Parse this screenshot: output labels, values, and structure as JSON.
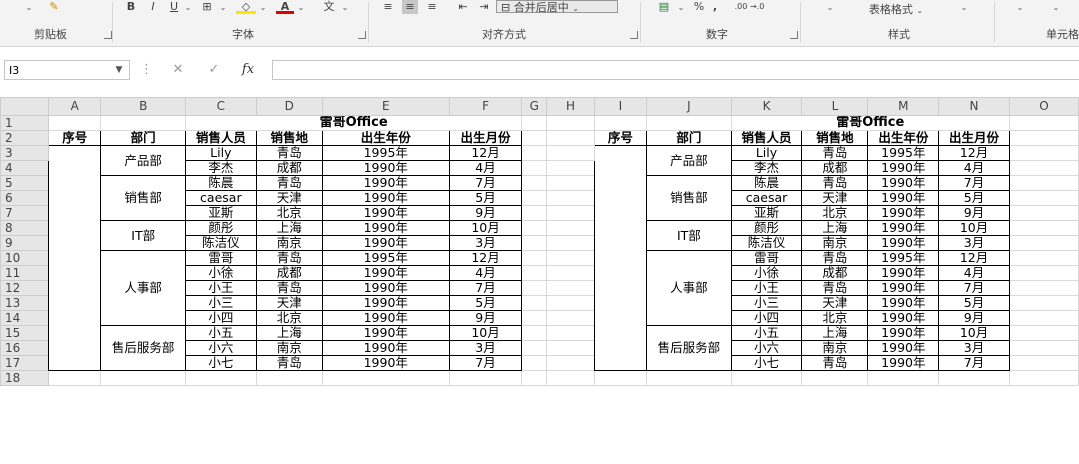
{
  "ribbon": {
    "clipboard_label": "剪贴板",
    "font_label": "字体",
    "align_label": "对齐方式",
    "number_label": "数字",
    "styles_label": "样式",
    "cells_label": "单元格",
    "bold": "B",
    "italic": "I",
    "underline": "U",
    "merge_center": "合并后居中",
    "percent": "%",
    "comma": ",",
    "table_format": "表格格式"
  },
  "formula_bar": {
    "name_box": "I3",
    "fx": "fx",
    "cancel": "✕",
    "enter": "✓"
  },
  "columns": [
    "A",
    "B",
    "C",
    "D",
    "E",
    "F",
    "G",
    "H",
    "I",
    "J",
    "K",
    "L",
    "M",
    "N",
    "O"
  ],
  "rows": [
    "1",
    "2",
    "3",
    "4",
    "5",
    "6",
    "7",
    "8",
    "9",
    "10",
    "11",
    "12",
    "13",
    "14",
    "15",
    "16",
    "17",
    "18"
  ],
  "table": {
    "title": "雷哥Office",
    "headers": [
      "序号",
      "部门",
      "销售人员",
      "销售地",
      "出生年份",
      "出生月份"
    ],
    "groups": [
      {
        "dept": "产品部",
        "span": 2
      },
      {
        "dept": "销售部",
        "span": 3
      },
      {
        "dept": "IT部",
        "span": 2
      },
      {
        "dept": "人事部",
        "span": 5
      },
      {
        "dept": "售后服务部",
        "span": 3
      }
    ],
    "records": [
      [
        "Lily",
        "青岛",
        "1995年",
        "12月"
      ],
      [
        "李杰",
        "成都",
        "1990年",
        "4月"
      ],
      [
        "陈晨",
        "青岛",
        "1990年",
        "7月"
      ],
      [
        "caesar",
        "天津",
        "1990年",
        "5月"
      ],
      [
        "亚斯",
        "北京",
        "1990年",
        "9月"
      ],
      [
        "颜彤",
        "上海",
        "1990年",
        "10月"
      ],
      [
        "陈洁仪",
        "南京",
        "1990年",
        "3月"
      ],
      [
        "雷哥",
        "青岛",
        "1995年",
        "12月"
      ],
      [
        "小徐",
        "成都",
        "1990年",
        "4月"
      ],
      [
        "小王",
        "青岛",
        "1990年",
        "7月"
      ],
      [
        "小三",
        "天津",
        "1990年",
        "5月"
      ],
      [
        "小四",
        "北京",
        "1990年",
        "9月"
      ],
      [
        "小五",
        "上海",
        "1990年",
        "10月"
      ],
      [
        "小六",
        "南京",
        "1990年",
        "3月"
      ],
      [
        "小七",
        "青岛",
        "1990年",
        "7月"
      ]
    ]
  }
}
